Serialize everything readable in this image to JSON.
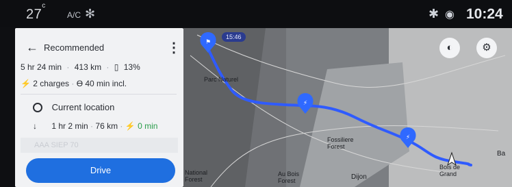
{
  "status": {
    "temperature": "27",
    "temperature_unit": "c",
    "ac_label": "A/C",
    "fan_icon": "fan-icon",
    "bluetooth_icon": "bluetooth-icon",
    "camera_icon": "camera-icon",
    "time": "10:24"
  },
  "panel": {
    "title": "Recommended",
    "duration": "5 hr 24 min",
    "distance": "413 km",
    "battery_icon": "battery-icon",
    "battery": "13%",
    "charges": "2 charges",
    "charge_time": "40 min incl.",
    "current_location": "Current location",
    "leg_duration": "1 hr 2 min",
    "leg_distance": "76 km",
    "leg_charge": "0 min",
    "next_stop_ghost": "AAA  SIEP 70",
    "drive_label": "Drive"
  },
  "map": {
    "time_pill": "15:46",
    "labels": {
      "natural_park": "Parc Naturel",
      "fossiliere": "Fossiliere Forest",
      "dijon": "Dijon",
      "bois_de_grand": "Bois de Grand",
      "ba": "Ba",
      "au_bois": "Au Bois Forest",
      "national": "National Forest"
    },
    "route_color": "#2f5bff",
    "charger_color": "#2f69ff"
  }
}
